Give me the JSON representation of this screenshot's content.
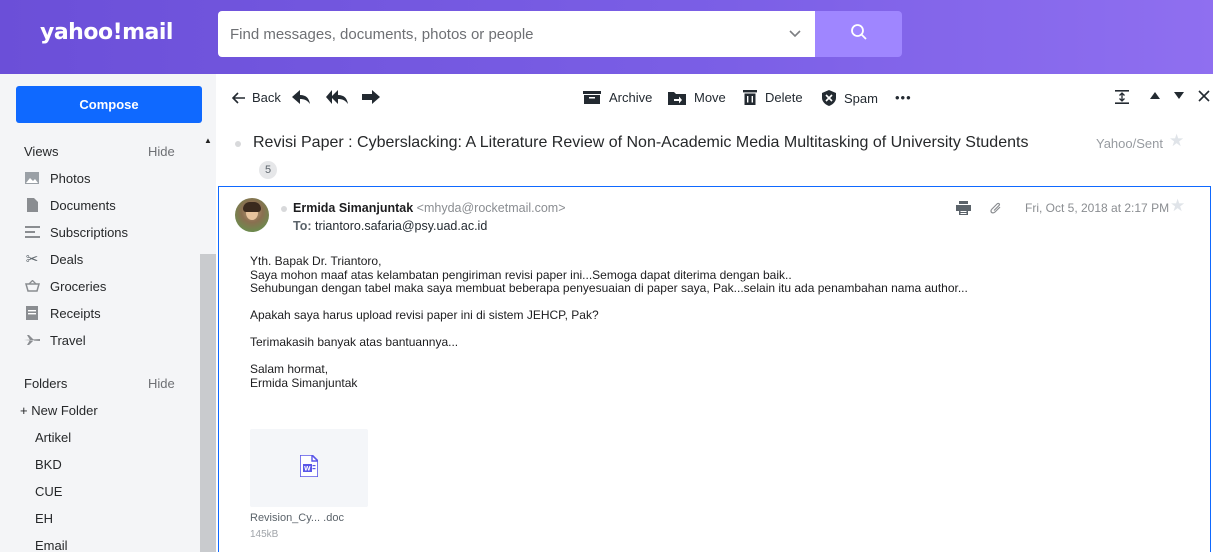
{
  "header": {
    "logo": "yahoo!mail",
    "search_placeholder": "Find messages, documents, photos or people",
    "icons": [
      "chevron-down-icon",
      "search-icon"
    ]
  },
  "sidebar": {
    "compose_label": "Compose",
    "views_title": "Views",
    "views_hide": "Hide",
    "views": [
      {
        "label": "Photos",
        "icon": "photos-icon"
      },
      {
        "label": "Documents",
        "icon": "documents-icon"
      },
      {
        "label": "Subscriptions",
        "icon": "subscriptions-icon"
      },
      {
        "label": "Deals",
        "icon": "deals-icon"
      },
      {
        "label": "Groceries",
        "icon": "groceries-icon"
      },
      {
        "label": "Receipts",
        "icon": "receipts-icon"
      },
      {
        "label": "Travel",
        "icon": "travel-icon"
      }
    ],
    "folders_title": "Folders",
    "folders_hide": "Hide",
    "new_folder": "+ New Folder",
    "folders": [
      "Artikel",
      "BKD",
      "CUE",
      "EH",
      "Email"
    ]
  },
  "toolbar": {
    "back": "Back",
    "archive": "Archive",
    "move": "Move",
    "delete": "Delete",
    "spam": "Spam",
    "more": "•••"
  },
  "message": {
    "subject": "Revisi Paper : Cyberslacking: A Literature Review of Non-Academic Media Multitasking of University Students",
    "thread_count": "5",
    "folder": "Yahoo/Sent",
    "sender_name": "Ermida Simanjuntak",
    "sender_email": "<mhyda@rocketmail.com>",
    "to_label": "To:",
    "to_address": "triantoro.safaria@psy.uad.ac.id",
    "date": "Fri, Oct 5, 2018 at 2:17 PM",
    "body": {
      "greeting": "Yth. Bapak Dr. Triantoro,",
      "line1": "Saya mohon maaf atas kelambatan pengiriman revisi paper ini...Semoga dapat diterima dengan baik..",
      "line2": "Sehubungan dengan tabel maka saya membuat beberapa penyesuaian di paper saya, Pak...selain itu ada penambahan nama author...",
      "line3": "Apakah saya harus upload revisi paper ini di sistem JEHCP, Pak?",
      "line4": "Terimakasih banyak atas bantuannya...",
      "closing": "Salam hormat,",
      "signature": "Ermida Simanjuntak"
    },
    "attachment": {
      "name": "Revision_Cy... .doc",
      "size": "145kB"
    }
  },
  "colors": {
    "header_purple": "#6b4fd8",
    "search_button": "#9f86ff",
    "compose_blue": "#0f69ff",
    "word_icon": "#5a57e8"
  }
}
